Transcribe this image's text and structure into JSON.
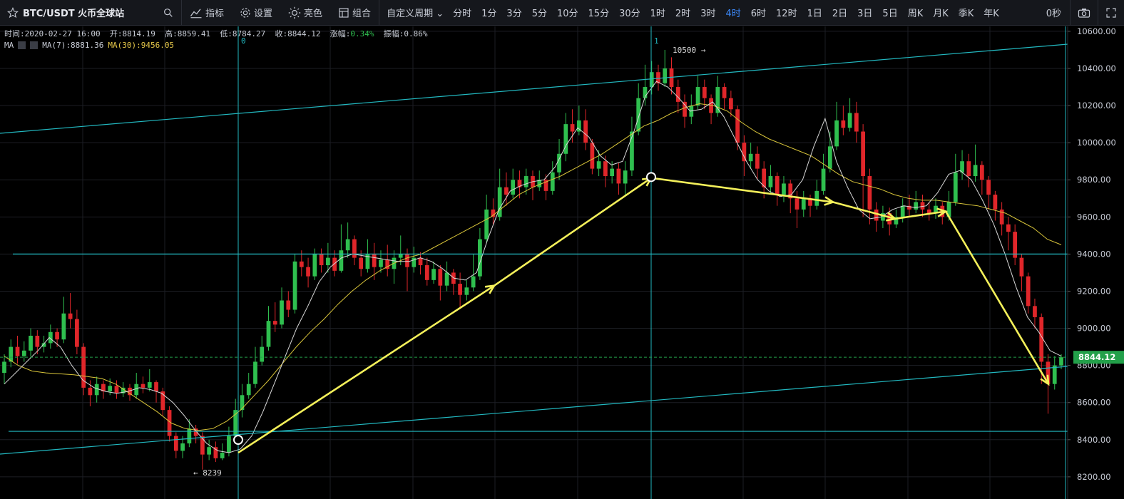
{
  "toolbar": {
    "symbol": "BTC/USDT 火币全球站",
    "buttons": [
      {
        "label": "指标",
        "icon": "indicator-icon"
      },
      {
        "label": "设置",
        "icon": "gear-icon"
      },
      {
        "label": "亮色",
        "icon": "sun-icon"
      },
      {
        "label": "组合",
        "icon": "layout-icon"
      }
    ],
    "custom_period": "自定义周期",
    "periods": [
      "分时",
      "1分",
      "3分",
      "5分",
      "10分",
      "15分",
      "30分",
      "1时",
      "2时",
      "3时",
      "4时",
      "6时",
      "12时",
      "1日",
      "2日",
      "3日",
      "5日",
      "周K",
      "月K",
      "季K",
      "年K"
    ],
    "active_period": "4时",
    "timer": "0秒"
  },
  "info": {
    "time": "时间:2020-02-27 16:00",
    "open": "开:8814.19",
    "high": "高:8859.41",
    "low": "低:8784.27",
    "close": "收:8844.12",
    "change_label": "涨幅:",
    "change_value": "0.34%",
    "amplitude": "振幅:0.86%"
  },
  "ma": {
    "label": "MA",
    "ma7": "MA(7):8881.36",
    "ma30": "MA(30):9456.05"
  },
  "colors": {
    "up": "#2fbf4f",
    "down": "#e0262a",
    "ma7": "#d8d8d8",
    "ma30": "#d9c53a",
    "drawing": "#22b8c0",
    "arrow": "#f4f05a",
    "price_tag": "#23a04a"
  },
  "chart_data": {
    "type": "candlestick",
    "y_axis_ticks": [
      10600,
      10400,
      10200,
      10000,
      9800,
      9600,
      9400,
      9200,
      9000,
      8800,
      8600,
      8400,
      8200
    ],
    "y_axis_labels": [
      "10600.00",
      "10400.00",
      "10200.00",
      "10000.00",
      "9800.00",
      "9600.00",
      "9400.00",
      "9200.00",
      "9000.00",
      "8800.00",
      "8600.00",
      "8400.00",
      "8200.00"
    ],
    "ylim": [
      8130,
      10680
    ],
    "last_price": 8844.12,
    "last_price_label": "8844.12",
    "marker_labels": [
      "0",
      "1"
    ],
    "max_label": "10500 →",
    "min_label": "← 8239",
    "horizontal_levels": [
      9400,
      8445
    ],
    "swing_points": [
      {
        "close": 8330
      },
      {
        "close": 9230
      },
      {
        "close": 9810
      },
      {
        "close": 9680
      },
      {
        "close": 9590
      },
      {
        "close": 9630
      },
      {
        "close": 8700
      }
    ],
    "anchors": [
      8380,
      9815
    ],
    "ma7_path": [
      8700,
      8760,
      8820,
      8880,
      8950,
      8900,
      8800,
      8720,
      8680,
      8660,
      8650,
      8660,
      8680,
      8670,
      8650,
      8600,
      8530,
      8450,
      8380,
      8340,
      8330,
      8350,
      8420,
      8550,
      8700,
      8850,
      9000,
      9120,
      9250,
      9330,
      9380,
      9400,
      9390,
      9380,
      9370,
      9360,
      9360,
      9380,
      9360,
      9320,
      9270,
      9260,
      9300,
      9480,
      9640,
      9740,
      9770,
      9790,
      9800,
      9870,
      9990,
      10080,
      10030,
      9930,
      9880,
      9900,
      10060,
      10250,
      10330,
      10300,
      10240,
      10170,
      10180,
      10220,
      10140,
      10020,
      9900,
      9800,
      9740,
      9710,
      9720,
      9800,
      9980,
      10130,
      9900,
      9760,
      9640,
      9590,
      9600,
      9640,
      9660,
      9650,
      9660,
      9730,
      9830,
      9850,
      9800,
      9690,
      9560,
      9400,
      9220,
      9060,
      8980,
      8880,
      8850
    ],
    "ma30_path": [
      8850,
      8800,
      8770,
      8760,
      8755,
      8750,
      8740,
      8730,
      8700,
      8650,
      8600,
      8550,
      8490,
      8460,
      8450,
      8460,
      8500,
      8560,
      8640,
      8720,
      8810,
      8900,
      8980,
      9050,
      9130,
      9200,
      9260,
      9310,
      9350,
      9380,
      9400,
      9440,
      9480,
      9520,
      9560,
      9600,
      9660,
      9720,
      9760,
      9790,
      9820,
      9860,
      9900,
      9940,
      9990,
      10040,
      10090,
      10120,
      10160,
      10190,
      10210,
      10200,
      10170,
      10110,
      10060,
      10020,
      9990,
      9960,
      9930,
      9880,
      9830,
      9790,
      9770,
      9750,
      9720,
      9700,
      9690,
      9690,
      9680,
      9670,
      9660,
      9640,
      9620,
      9580,
      9540,
      9480,
      9450
    ],
    "candles": [
      {
        "o": 8760,
        "c": 8820,
        "h": 8860,
        "l": 8700
      },
      {
        "o": 8820,
        "c": 8900,
        "h": 8940,
        "l": 8790
      },
      {
        "o": 8900,
        "c": 8850,
        "h": 8960,
        "l": 8810
      },
      {
        "o": 8850,
        "c": 8880,
        "h": 8930,
        "l": 8820
      },
      {
        "o": 8880,
        "c": 8960,
        "h": 9000,
        "l": 8850
      },
      {
        "o": 8960,
        "c": 8900,
        "h": 8990,
        "l": 8860
      },
      {
        "o": 8900,
        "c": 8920,
        "h": 8960,
        "l": 8870
      },
      {
        "o": 8920,
        "c": 8980,
        "h": 9020,
        "l": 8890
      },
      {
        "o": 8980,
        "c": 8940,
        "h": 9000,
        "l": 8900
      },
      {
        "o": 8940,
        "c": 9080,
        "h": 9170,
        "l": 8920
      },
      {
        "o": 9080,
        "c": 9050,
        "h": 9190,
        "l": 9000
      },
      {
        "o": 9050,
        "c": 8900,
        "h": 9100,
        "l": 8860
      },
      {
        "o": 8900,
        "c": 8680,
        "h": 8920,
        "l": 8640
      },
      {
        "o": 8680,
        "c": 8640,
        "h": 8720,
        "l": 8580
      },
      {
        "o": 8640,
        "c": 8700,
        "h": 8740,
        "l": 8600
      },
      {
        "o": 8700,
        "c": 8660,
        "h": 8720,
        "l": 8620
      },
      {
        "o": 8660,
        "c": 8690,
        "h": 8730,
        "l": 8640
      },
      {
        "o": 8690,
        "c": 8650,
        "h": 8720,
        "l": 8620
      },
      {
        "o": 8650,
        "c": 8680,
        "h": 8710,
        "l": 8630
      },
      {
        "o": 8680,
        "c": 8640,
        "h": 8700,
        "l": 8610
      },
      {
        "o": 8640,
        "c": 8700,
        "h": 8760,
        "l": 8620
      },
      {
        "o": 8700,
        "c": 8680,
        "h": 8740,
        "l": 8650
      },
      {
        "o": 8680,
        "c": 8710,
        "h": 8780,
        "l": 8660
      },
      {
        "o": 8710,
        "c": 8660,
        "h": 8720,
        "l": 8600
      },
      {
        "o": 8660,
        "c": 8560,
        "h": 8680,
        "l": 8530
      },
      {
        "o": 8560,
        "c": 8420,
        "h": 8580,
        "l": 8390
      },
      {
        "o": 8420,
        "c": 8340,
        "h": 8440,
        "l": 8300
      },
      {
        "o": 8340,
        "c": 8380,
        "h": 8420,
        "l": 8300
      },
      {
        "o": 8380,
        "c": 8460,
        "h": 8510,
        "l": 8360
      },
      {
        "o": 8460,
        "c": 8420,
        "h": 8480,
        "l": 8380
      },
      {
        "o": 8420,
        "c": 8320,
        "h": 8440,
        "l": 8239
      },
      {
        "o": 8320,
        "c": 8360,
        "h": 8400,
        "l": 8290
      },
      {
        "o": 8360,
        "c": 8300,
        "h": 8390,
        "l": 8280
      },
      {
        "o": 8300,
        "c": 8330,
        "h": 8380,
        "l": 8290
      },
      {
        "o": 8330,
        "c": 8420,
        "h": 8470,
        "l": 8310
      },
      {
        "o": 8420,
        "c": 8560,
        "h": 8620,
        "l": 8400
      },
      {
        "o": 8560,
        "c": 8640,
        "h": 8700,
        "l": 8520
      },
      {
        "o": 8640,
        "c": 8700,
        "h": 8760,
        "l": 8620
      },
      {
        "o": 8700,
        "c": 8820,
        "h": 8900,
        "l": 8680
      },
      {
        "o": 8820,
        "c": 8900,
        "h": 8960,
        "l": 8800
      },
      {
        "o": 8900,
        "c": 9040,
        "h": 9120,
        "l": 8880
      },
      {
        "o": 9040,
        "c": 9020,
        "h": 9140,
        "l": 8980
      },
      {
        "o": 9020,
        "c": 9150,
        "h": 9220,
        "l": 9000
      },
      {
        "o": 9150,
        "c": 9100,
        "h": 9200,
        "l": 9060
      },
      {
        "o": 9100,
        "c": 9360,
        "h": 9400,
        "l": 9080
      },
      {
        "o": 9360,
        "c": 9330,
        "h": 9420,
        "l": 9280
      },
      {
        "o": 9330,
        "c": 9280,
        "h": 9380,
        "l": 9220
      },
      {
        "o": 9280,
        "c": 9400,
        "h": 9430,
        "l": 9260
      },
      {
        "o": 9400,
        "c": 9340,
        "h": 9430,
        "l": 9300
      },
      {
        "o": 9340,
        "c": 9380,
        "h": 9460,
        "l": 9300
      },
      {
        "o": 9380,
        "c": 9310,
        "h": 9420,
        "l": 9280
      },
      {
        "o": 9310,
        "c": 9420,
        "h": 9560,
        "l": 9300
      },
      {
        "o": 9420,
        "c": 9480,
        "h": 9570,
        "l": 9380
      },
      {
        "o": 9480,
        "c": 9380,
        "h": 9500,
        "l": 9340
      },
      {
        "o": 9380,
        "c": 9320,
        "h": 9420,
        "l": 9280
      },
      {
        "o": 9320,
        "c": 9400,
        "h": 9480,
        "l": 9300
      },
      {
        "o": 9400,
        "c": 9330,
        "h": 9460,
        "l": 9260
      },
      {
        "o": 9330,
        "c": 9370,
        "h": 9420,
        "l": 9300
      },
      {
        "o": 9370,
        "c": 9320,
        "h": 9450,
        "l": 9280
      },
      {
        "o": 9320,
        "c": 9380,
        "h": 9420,
        "l": 9240
      },
      {
        "o": 9380,
        "c": 9400,
        "h": 9500,
        "l": 9340
      },
      {
        "o": 9400,
        "c": 9330,
        "h": 9430,
        "l": 9200
      },
      {
        "o": 9330,
        "c": 9380,
        "h": 9440,
        "l": 9300
      },
      {
        "o": 9380,
        "c": 9340,
        "h": 9410,
        "l": 9290
      },
      {
        "o": 9340,
        "c": 9260,
        "h": 9380,
        "l": 9230
      },
      {
        "o": 9260,
        "c": 9320,
        "h": 9360,
        "l": 9240
      },
      {
        "o": 9320,
        "c": 9230,
        "h": 9340,
        "l": 9150
      },
      {
        "o": 9230,
        "c": 9300,
        "h": 9360,
        "l": 9200
      },
      {
        "o": 9300,
        "c": 9240,
        "h": 9320,
        "l": 9180
      },
      {
        "o": 9240,
        "c": 9180,
        "h": 9300,
        "l": 9110
      },
      {
        "o": 9180,
        "c": 9220,
        "h": 9260,
        "l": 9150
      },
      {
        "o": 9220,
        "c": 9280,
        "h": 9400,
        "l": 9200
      },
      {
        "o": 9280,
        "c": 9480,
        "h": 9540,
        "l": 9260
      },
      {
        "o": 9480,
        "c": 9640,
        "h": 9720,
        "l": 9460
      },
      {
        "o": 9640,
        "c": 9600,
        "h": 9700,
        "l": 9560
      },
      {
        "o": 9600,
        "c": 9760,
        "h": 9860,
        "l": 9580
      },
      {
        "o": 9760,
        "c": 9720,
        "h": 9840,
        "l": 9660
      },
      {
        "o": 9720,
        "c": 9800,
        "h": 9860,
        "l": 9700
      },
      {
        "o": 9800,
        "c": 9760,
        "h": 9850,
        "l": 9700
      },
      {
        "o": 9760,
        "c": 9820,
        "h": 9860,
        "l": 9720
      },
      {
        "o": 9820,
        "c": 9760,
        "h": 9850,
        "l": 9690
      },
      {
        "o": 9760,
        "c": 9800,
        "h": 9850,
        "l": 9740
      },
      {
        "o": 9800,
        "c": 9740,
        "h": 9830,
        "l": 9690
      },
      {
        "o": 9740,
        "c": 9840,
        "h": 9900,
        "l": 9720
      },
      {
        "o": 9840,
        "c": 9940,
        "h": 10020,
        "l": 9800
      },
      {
        "o": 9940,
        "c": 10100,
        "h": 10160,
        "l": 9900
      },
      {
        "o": 10100,
        "c": 10060,
        "h": 10180,
        "l": 10000
      },
      {
        "o": 10060,
        "c": 10120,
        "h": 10200,
        "l": 10040
      },
      {
        "o": 10120,
        "c": 10000,
        "h": 10180,
        "l": 9960
      },
      {
        "o": 10000,
        "c": 9860,
        "h": 10020,
        "l": 9830
      },
      {
        "o": 9860,
        "c": 9900,
        "h": 9960,
        "l": 9820
      },
      {
        "o": 9900,
        "c": 9820,
        "h": 9930,
        "l": 9760
      },
      {
        "o": 9820,
        "c": 9860,
        "h": 9900,
        "l": 9780
      },
      {
        "o": 9860,
        "c": 9780,
        "h": 9890,
        "l": 9720
      },
      {
        "o": 9780,
        "c": 9850,
        "h": 9900,
        "l": 9720
      },
      {
        "o": 9850,
        "c": 10060,
        "h": 10140,
        "l": 9820
      },
      {
        "o": 10060,
        "c": 10240,
        "h": 10320,
        "l": 10040
      },
      {
        "o": 10240,
        "c": 10300,
        "h": 10420,
        "l": 10200
      },
      {
        "o": 10300,
        "c": 10380,
        "h": 10440,
        "l": 10260
      },
      {
        "o": 10380,
        "c": 10320,
        "h": 10420,
        "l": 10280
      },
      {
        "o": 10320,
        "c": 10400,
        "h": 10500,
        "l": 10300
      },
      {
        "o": 10400,
        "c": 10300,
        "h": 10460,
        "l": 10260
      },
      {
        "o": 10300,
        "c": 10220,
        "h": 10340,
        "l": 10160
      },
      {
        "o": 10220,
        "c": 10140,
        "h": 10260,
        "l": 10080
      },
      {
        "o": 10140,
        "c": 10200,
        "h": 10260,
        "l": 10100
      },
      {
        "o": 10200,
        "c": 10300,
        "h": 10360,
        "l": 10180
      },
      {
        "o": 10300,
        "c": 10240,
        "h": 10340,
        "l": 10180
      },
      {
        "o": 10240,
        "c": 10160,
        "h": 10260,
        "l": 10100
      },
      {
        "o": 10160,
        "c": 10300,
        "h": 10360,
        "l": 10140
      },
      {
        "o": 10300,
        "c": 10240,
        "h": 10320,
        "l": 10180
      },
      {
        "o": 10240,
        "c": 10180,
        "h": 10280,
        "l": 10140
      },
      {
        "o": 10180,
        "c": 10000,
        "h": 10200,
        "l": 9960
      },
      {
        "o": 10000,
        "c": 9900,
        "h": 10040,
        "l": 9820
      },
      {
        "o": 9900,
        "c": 9940,
        "h": 10000,
        "l": 9860
      },
      {
        "o": 9940,
        "c": 9860,
        "h": 9980,
        "l": 9800
      },
      {
        "o": 9860,
        "c": 9760,
        "h": 9900,
        "l": 9700
      },
      {
        "o": 9760,
        "c": 9820,
        "h": 9880,
        "l": 9720
      },
      {
        "o": 9820,
        "c": 9720,
        "h": 9840,
        "l": 9660
      },
      {
        "o": 9720,
        "c": 9780,
        "h": 9820,
        "l": 9680
      },
      {
        "o": 9780,
        "c": 9700,
        "h": 9800,
        "l": 9620
      },
      {
        "o": 9700,
        "c": 9640,
        "h": 9740,
        "l": 9540
      },
      {
        "o": 9640,
        "c": 9700,
        "h": 9740,
        "l": 9600
      },
      {
        "o": 9700,
        "c": 9660,
        "h": 9720,
        "l": 9600
      },
      {
        "o": 9660,
        "c": 9740,
        "h": 9800,
        "l": 9640
      },
      {
        "o": 9740,
        "c": 9860,
        "h": 9940,
        "l": 9720
      },
      {
        "o": 9860,
        "c": 9980,
        "h": 10060,
        "l": 9840
      },
      {
        "o": 9980,
        "c": 10120,
        "h": 10220,
        "l": 9960
      },
      {
        "o": 10120,
        "c": 10080,
        "h": 10200,
        "l": 10040
      },
      {
        "o": 10080,
        "c": 10160,
        "h": 10240,
        "l": 10060
      },
      {
        "o": 10160,
        "c": 10060,
        "h": 10220,
        "l": 10000
      },
      {
        "o": 10060,
        "c": 9820,
        "h": 10100,
        "l": 9600
      },
      {
        "o": 9820,
        "c": 9640,
        "h": 9860,
        "l": 9560
      },
      {
        "o": 9640,
        "c": 9580,
        "h": 9680,
        "l": 9520
      },
      {
        "o": 9580,
        "c": 9620,
        "h": 9660,
        "l": 9540
      },
      {
        "o": 9620,
        "c": 9560,
        "h": 9650,
        "l": 9500
      },
      {
        "o": 9560,
        "c": 9600,
        "h": 9640,
        "l": 9540
      },
      {
        "o": 9600,
        "c": 9660,
        "h": 9700,
        "l": 9570
      },
      {
        "o": 9660,
        "c": 9640,
        "h": 9720,
        "l": 9600
      },
      {
        "o": 9640,
        "c": 9680,
        "h": 9740,
        "l": 9620
      },
      {
        "o": 9680,
        "c": 9640,
        "h": 9720,
        "l": 9600
      },
      {
        "o": 9640,
        "c": 9620,
        "h": 9680,
        "l": 9580
      },
      {
        "o": 9620,
        "c": 9660,
        "h": 9700,
        "l": 9590
      },
      {
        "o": 9660,
        "c": 9600,
        "h": 9680,
        "l": 9560
      },
      {
        "o": 9600,
        "c": 9680,
        "h": 9740,
        "l": 9580
      },
      {
        "o": 9680,
        "c": 9840,
        "h": 9940,
        "l": 9660
      },
      {
        "o": 9840,
        "c": 9900,
        "h": 9960,
        "l": 9800
      },
      {
        "o": 9900,
        "c": 9820,
        "h": 9940,
        "l": 9760
      },
      {
        "o": 9820,
        "c": 9880,
        "h": 9990,
        "l": 9790
      },
      {
        "o": 9880,
        "c": 9800,
        "h": 9900,
        "l": 9720
      },
      {
        "o": 9800,
        "c": 9720,
        "h": 9820,
        "l": 9640
      },
      {
        "o": 9720,
        "c": 9640,
        "h": 9740,
        "l": 9580
      },
      {
        "o": 9640,
        "c": 9560,
        "h": 9680,
        "l": 9500
      },
      {
        "o": 9560,
        "c": 9520,
        "h": 9600,
        "l": 9420
      },
      {
        "o": 9520,
        "c": 9380,
        "h": 9560,
        "l": 9340
      },
      {
        "o": 9380,
        "c": 9280,
        "h": 9400,
        "l": 9200
      },
      {
        "o": 9280,
        "c": 9120,
        "h": 9300,
        "l": 9080
      },
      {
        "o": 9120,
        "c": 9060,
        "h": 9160,
        "l": 9000
      },
      {
        "o": 9060,
        "c": 8820,
        "h": 9080,
        "l": 8700
      },
      {
        "o": 8820,
        "c": 8700,
        "h": 8860,
        "l": 8540
      },
      {
        "o": 8700,
        "c": 8800,
        "h": 8850,
        "l": 8670
      },
      {
        "o": 8800,
        "c": 8844,
        "h": 8860,
        "l": 8780
      }
    ]
  }
}
